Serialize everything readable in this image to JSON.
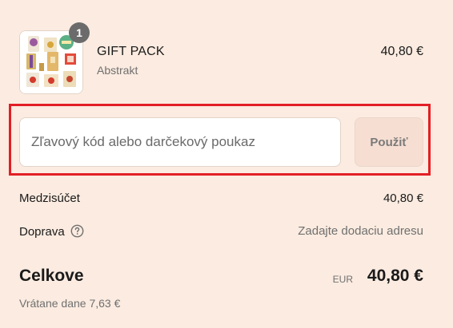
{
  "product": {
    "quantity": "1",
    "name": "GIFT PACK",
    "variant": "Abstrakt",
    "price": "40,80 €",
    "image_alt": "gift-pack-product-photo"
  },
  "discount": {
    "placeholder": "Zľavový kód alebo darčekový poukaz",
    "value": "",
    "apply_label": "Použiť"
  },
  "summary": {
    "subtotal_label": "Medzisúčet",
    "subtotal_value": "40,80 €",
    "shipping_label": "Doprava",
    "shipping_help_icon": "question-circle-icon",
    "shipping_value": "Zadajte dodaciu adresu"
  },
  "total": {
    "label": "Celkove",
    "currency": "EUR",
    "amount": "40,80 €",
    "tax_note": "Vrátane dane 7,63 €"
  },
  "colors": {
    "background": "#fbebe0",
    "highlight": "#e31e24",
    "apply_button_bg": "#f6ded2",
    "badge": "#6b6b6b"
  }
}
